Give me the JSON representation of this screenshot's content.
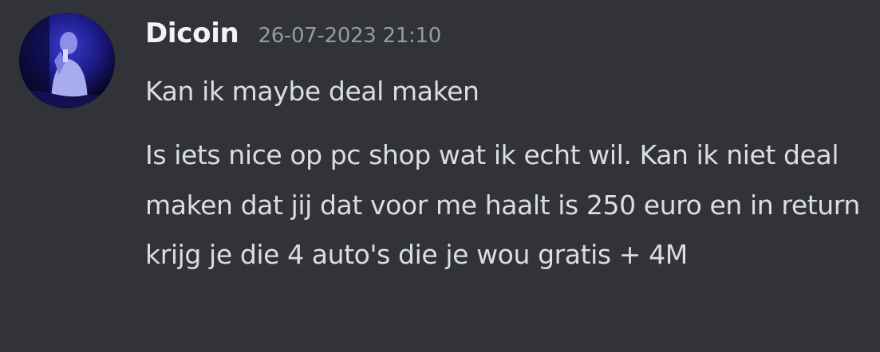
{
  "message": {
    "author": {
      "username": "Dicoin",
      "avatar_icon": "user-avatar"
    },
    "timestamp": "26-07-2023 21:10",
    "lines": [
      "Kan ik maybe deal maken",
      "Is iets nice op pc shop wat ik echt wil. Kan ik niet deal maken dat jij dat voor me haalt is 250 euro en in return krijg je die 4 auto's die je wou gratis + 4M"
    ]
  },
  "colors": {
    "background": "#313338",
    "username": "#f2f3f5",
    "timestamp": "#949ba4",
    "text": "#dbdee1"
  }
}
